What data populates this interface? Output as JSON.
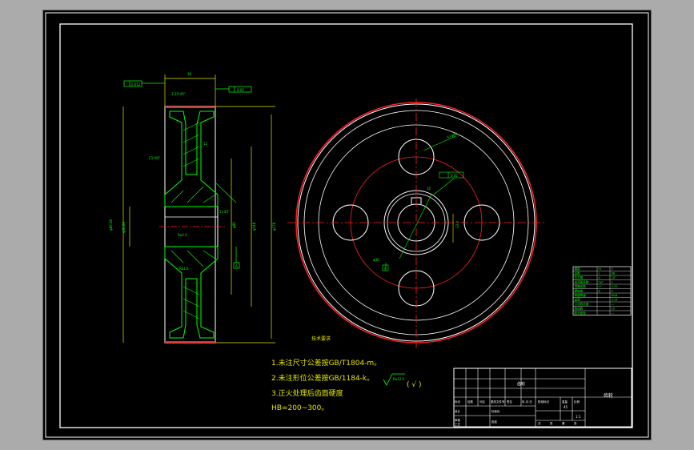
{
  "drawing": {
    "title": "齿轮",
    "notes": {
      "heading": "技术要求",
      "lines": [
        "1.未注尺寸公差按GB/T1804-m。",
        "2.未注形位公差按GB/1184-k。",
        "3.正火处理后齿面硬度",
        "HB=200~300。"
      ]
    },
    "surface_finish": {
      "label": "Ra12.5",
      "suffix": "( √ )"
    },
    "section_view": {
      "width_dim": "30",
      "chamfer": "3.15*45°",
      "tolerance_left": "0.012",
      "tolerance_right": "0.02",
      "datum_a": "A",
      "diameters_left": [
        "φ80.06",
        "φ30.06"
      ],
      "dim_right_a": "φ80",
      "dim_right_b": "φ148",
      "dim_right_c": "φ176",
      "hub_dim": "12",
      "chamfer_hub": "C1*45°",
      "roughness_a": "Ra3.2",
      "roughness_b": "Ra1.6",
      "angle": "1×45°"
    },
    "front_view": {
      "hole_dim": "4×φ40",
      "bore_dim": "φ30",
      "tolerance": "0.02",
      "datum": "A",
      "keyway_dim": "10",
      "keyway_depth": "33.3"
    },
    "param_table": {
      "rows": [
        [
          "模数",
          "m",
          "2"
        ],
        [
          "齿数",
          "z",
          "88"
        ],
        [
          "压力角",
          "α",
          "20°"
        ],
        [
          "齿顶高系数",
          "ha*",
          "1"
        ],
        [
          "顶隙系数",
          "c*",
          "0.25"
        ],
        [
          "螺旋角",
          "β",
          "0"
        ],
        [
          "精度等级",
          "",
          "8GB"
        ],
        [
          "齿厚",
          "",
          "3.14"
        ],
        [
          "公法线长度",
          "",
          "—"
        ],
        [
          "跨齿数",
          "",
          "10"
        ],
        [
          "配对齿轮",
          "",
          "—"
        ]
      ]
    },
    "title_block": {
      "part_name": "齿轮",
      "material": "45",
      "scale": "1:1",
      "header_cells": [
        "标记",
        "处数",
        "分区",
        "更改文件号",
        "签名",
        "年.月.日"
      ],
      "role_cells": [
        "设计",
        "审核",
        "工艺"
      ],
      "stage_cells": [
        "阶段标记",
        "重量",
        "比例"
      ],
      "sheet_cells": [
        "共",
        "张",
        "第",
        "张"
      ],
      "std_label": "标准化",
      "approve_label": "批准"
    }
  }
}
